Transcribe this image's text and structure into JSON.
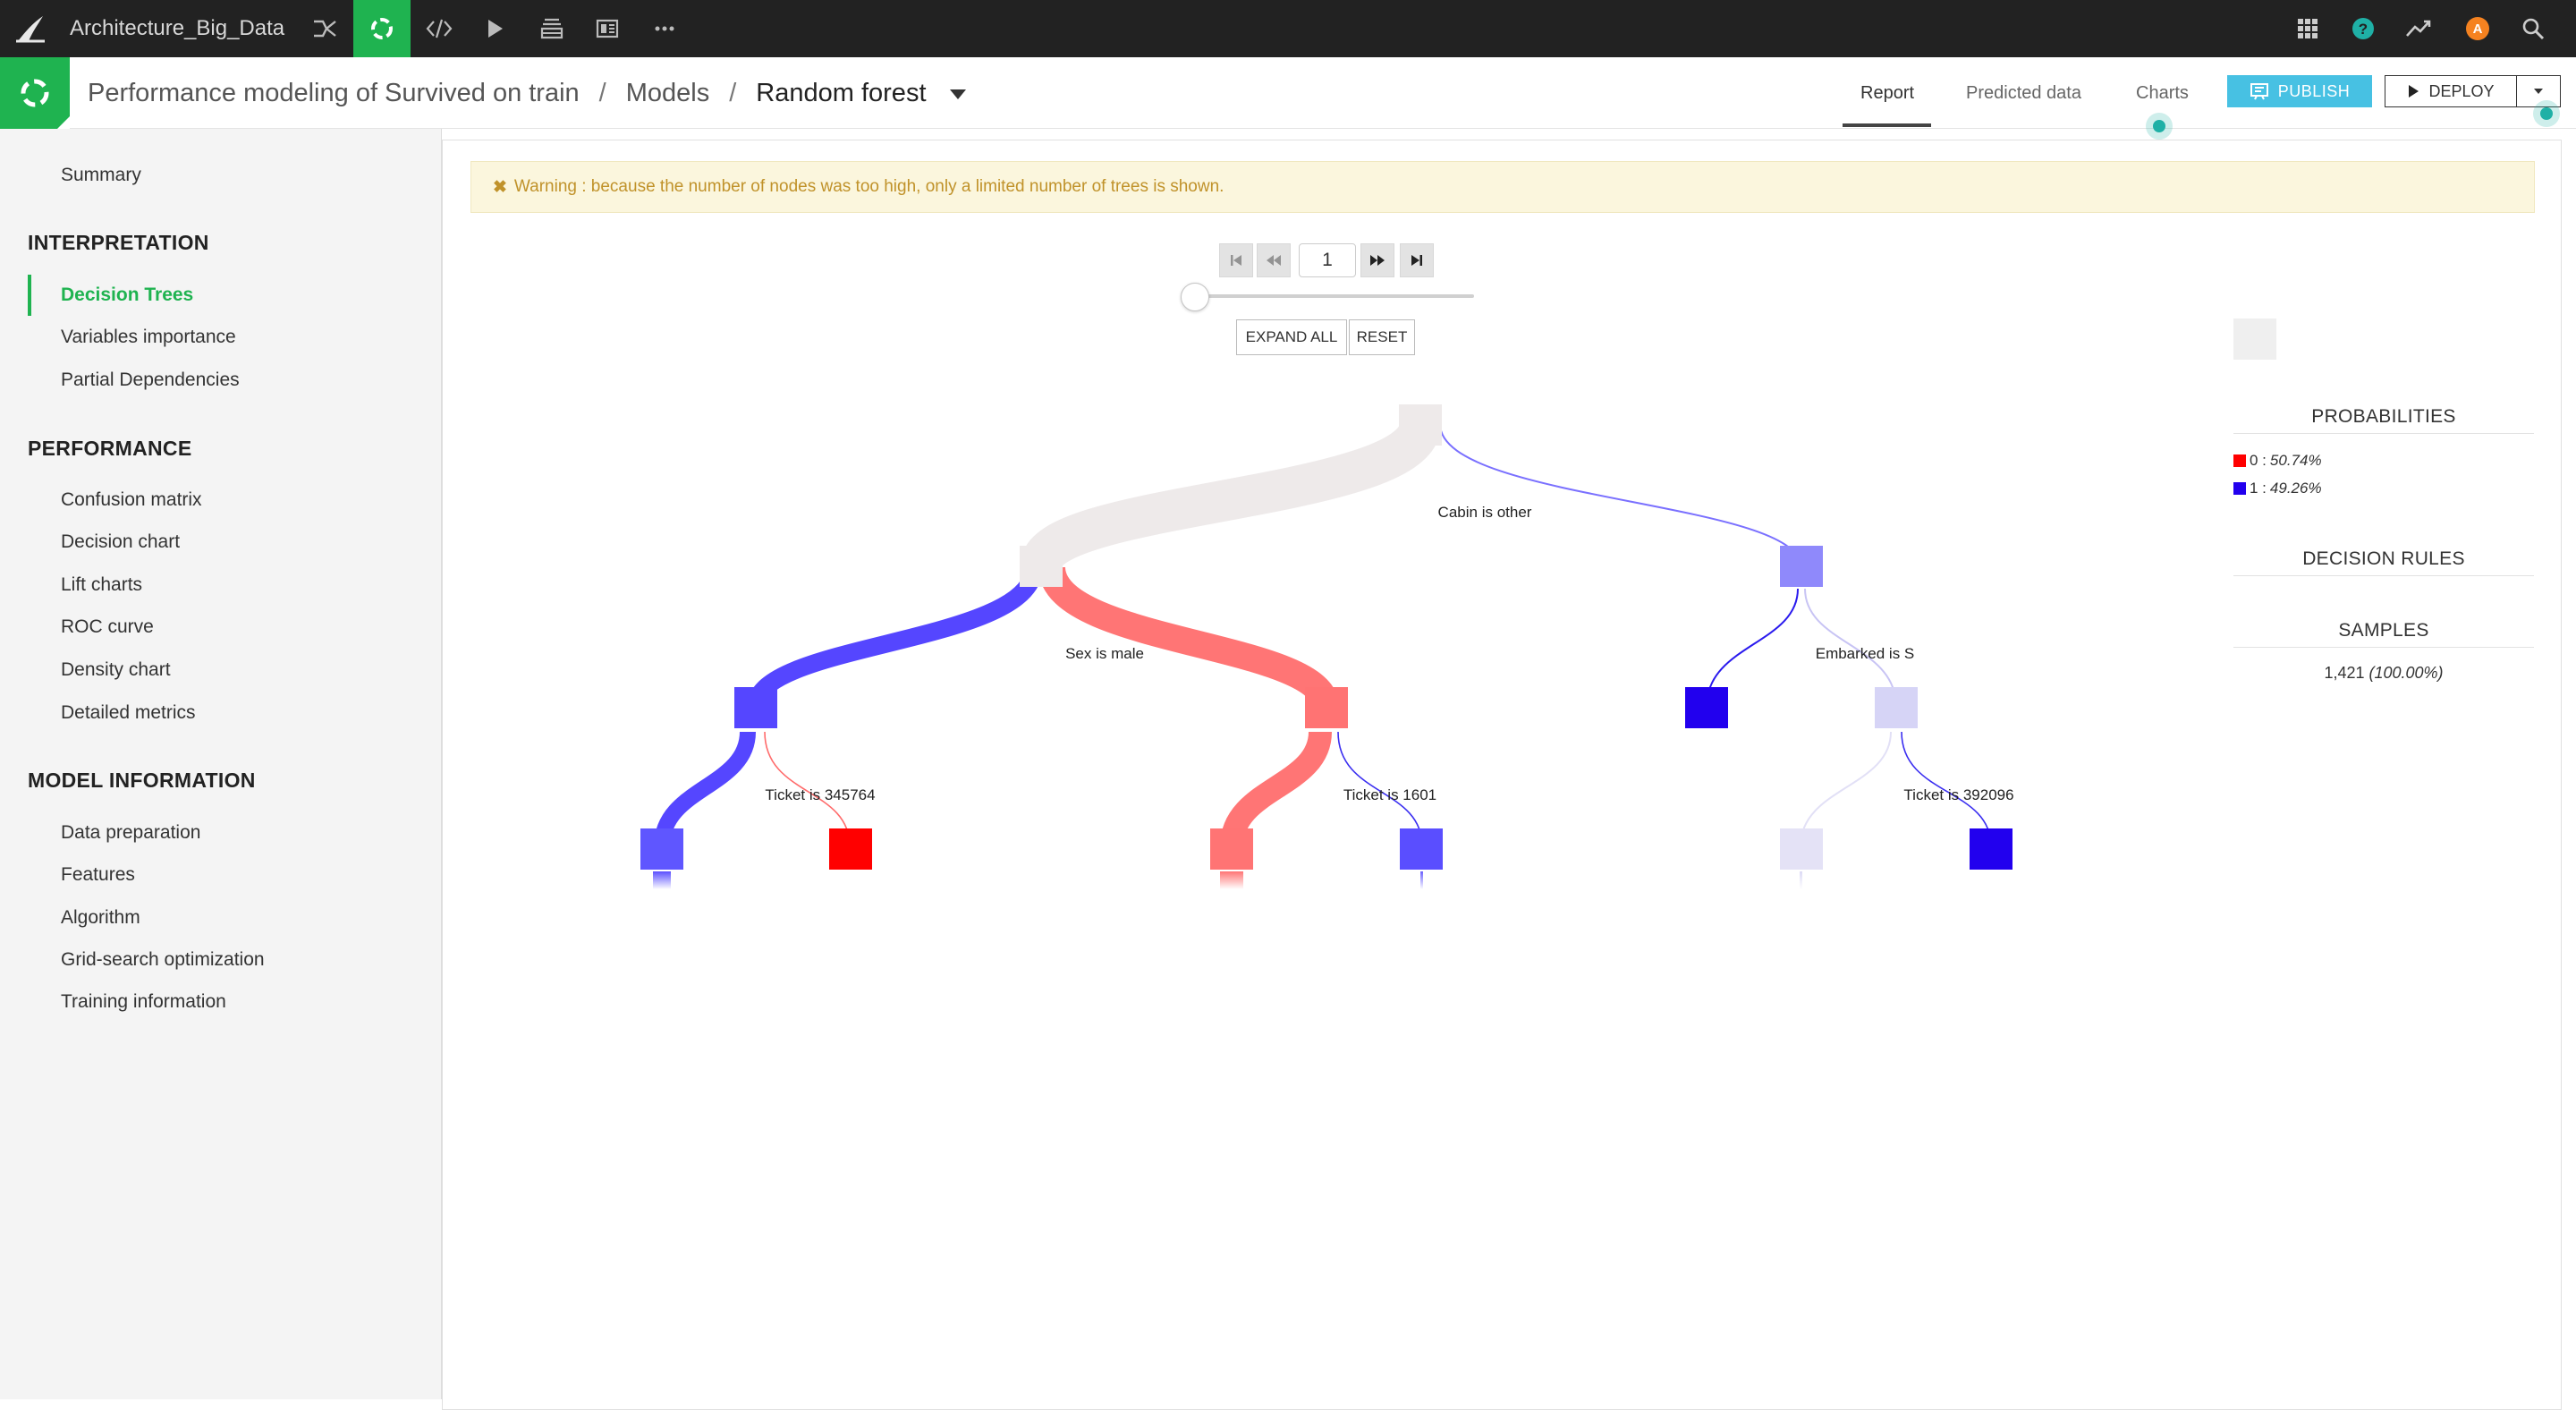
{
  "topbar": {
    "project_name": "Architecture_Big_Data",
    "icons": [
      "flow-icon",
      "ml-icon",
      "code-icon",
      "run-icon",
      "datasets-icon",
      "dashboard-icon",
      "more-icon"
    ],
    "right_icons": [
      "apps-grid-icon",
      "help-icon",
      "activity-icon",
      "user-avatar",
      "search-icon"
    ],
    "avatar_letter": "A",
    "colors": {
      "bar": "#222222",
      "active": "#1fb350",
      "help": "#1fb0a6",
      "avatar": "#f58220"
    }
  },
  "breadcrumb": {
    "part1": "Performance modeling of Survived on train",
    "sep1": "/",
    "part2": "Models",
    "sep2": "/",
    "current": "Random forest"
  },
  "tabs": {
    "report": "Report",
    "predicted": "Predicted data",
    "charts": "Charts"
  },
  "actions": {
    "publish": "PUBLISH",
    "deploy": "DEPLOY"
  },
  "sidebar": {
    "summary": "Summary",
    "interpretation_heading": "INTERPRETATION",
    "interpretation": [
      "Decision Trees",
      "Variables importance",
      "Partial Dependencies"
    ],
    "performance_heading": "PERFORMANCE",
    "performance": [
      "Confusion matrix",
      "Decision chart",
      "Lift charts",
      "ROC curve",
      "Density chart",
      "Detailed metrics"
    ],
    "model_info_heading": "MODEL INFORMATION",
    "model_info": [
      "Data preparation",
      "Features",
      "Algorithm",
      "Grid-search optimization",
      "Training information"
    ],
    "active_item": "Decision Trees"
  },
  "warning": {
    "icon": "✖",
    "text": "Warning : because the number of nodes was too high, only a limited number of trees is shown."
  },
  "pager": {
    "current_tree": "1",
    "slider_position": 0,
    "expand_all": "EXPAND ALL",
    "reset": "RESET"
  },
  "tree": {
    "split_labels": [
      "Cabin is other",
      "Sex is male",
      "Embarked is S",
      "Ticket is 345764",
      "Ticket is 1601",
      "Ticket is 392096"
    ]
  },
  "info": {
    "probabilities_heading": "PROBABILITIES",
    "prob_0_label": "0 :",
    "prob_0_value": "50.74%",
    "prob_1_label": "1 :",
    "prob_1_value": "49.26%",
    "decision_rules_heading": "DECISION RULES",
    "samples_heading": "SAMPLES",
    "samples_count": "1,421",
    "samples_pct": "(100.00%)",
    "colors": {
      "class0": "#ff0000",
      "class1": "#2200ee"
    }
  }
}
